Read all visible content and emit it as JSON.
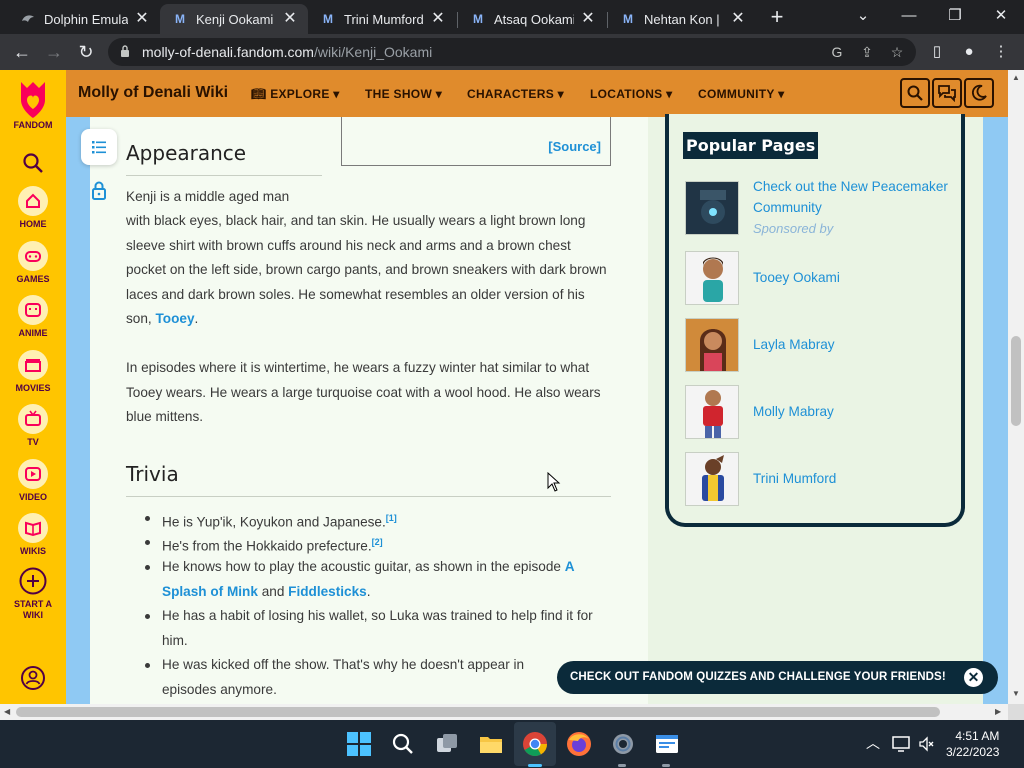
{
  "browser": {
    "tabs": [
      {
        "title": "Dolphin Emulator",
        "active": false
      },
      {
        "title": "Kenji Ookami | M",
        "active": true
      },
      {
        "title": "Trini Mumford | M",
        "active": false
      },
      {
        "title": "Atsaq Ookami | M",
        "active": false
      },
      {
        "title": "Nehtan Kon | M",
        "active": false
      }
    ],
    "url_domain": "molly-of-denali.fandom.com",
    "url_path": "/wiki/Kenji_Ookami"
  },
  "rail": {
    "items": [
      {
        "label": "FANDOM"
      },
      {
        "label": "HOME"
      },
      {
        "label": "GAMES"
      },
      {
        "label": "ANIME"
      },
      {
        "label": "MOVIES"
      },
      {
        "label": "TV"
      },
      {
        "label": "VIDEO"
      },
      {
        "label": "WIKIS"
      },
      {
        "label": "START A WIKI"
      }
    ]
  },
  "wiki_header": {
    "name": "Molly of Denali Wiki",
    "nav": [
      "EXPLORE",
      "THE SHOW",
      "CHARACTERS",
      "LOCATIONS",
      "COMMUNITY"
    ]
  },
  "infobox": {
    "source_label": "[Source]"
  },
  "article": {
    "appearance_heading": "Appearance",
    "appearance_first_line": "Kenji is a middle aged man",
    "appearance_body": "with black eyes, black hair, and tan skin. He usually wears a light brown long sleeve shirt with brown cuffs around his neck and arms and a brown chest pocket on the left side, brown cargo pants, and brown sneakers with dark brown laces and dark brown soles. He somewhat resembles an older version of his son, ",
    "appearance_link": "Tooey",
    "appearance_end": ".",
    "winter_paragraph": "In episodes where it is wintertime, he wears a fuzzy winter hat similar to what Tooey wears. He wears a large turquoise coat with a wool hood. He also wears blue mittens.",
    "trivia_heading": "Trivia",
    "trivia": {
      "item1": "He is Yup'ik, Koyukon and Japanese.",
      "item1_ref": "[1]",
      "item2": "He's from the Hokkaido prefecture.",
      "item2_ref": "[2]",
      "item3_pre": "He knows how to play the acoustic guitar, as shown in the episode ",
      "item3_link1": "A Splash of Mink",
      "item3_mid": " and ",
      "item3_link2": "Fiddlesticks",
      "item3_end": ".",
      "item4": "He has a habit of losing his wallet, so Luka was trained to help find it for him.",
      "item5": "He was kicked off the show. That's why he doesn't appear in episodes anymore."
    }
  },
  "popular": {
    "title": "Popular Pages",
    "sponsored_title": "Check out the New Peacemaker Community",
    "sponsored_by": "Sponsored by",
    "pages": [
      "Tooey Ookami",
      "Layla Mabray",
      "Molly Mabray",
      "Trini Mumford"
    ]
  },
  "quiz_banner": {
    "text": "CHECK OUT FANDOM QUIZZES AND CHALLENGE YOUR FRIENDS!"
  },
  "taskbar": {
    "time": "4:51 AM",
    "date": "3/22/2023"
  },
  "colors": {
    "fandom_yellow": "#ffc500",
    "wiki_orange": "#e08b2c",
    "link_blue": "#1e90d6",
    "navy": "#0b2a3a"
  }
}
